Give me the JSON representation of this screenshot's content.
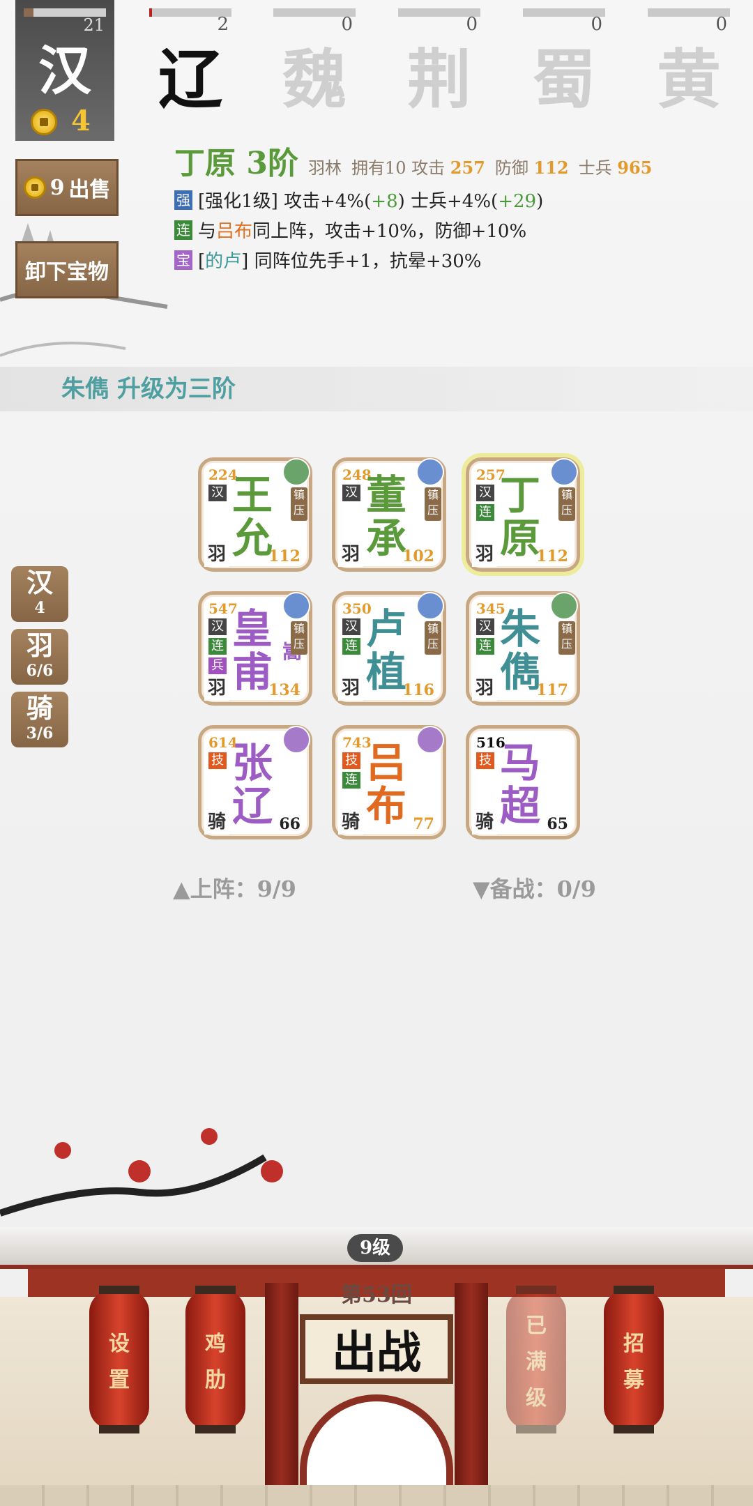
{
  "factions": {
    "main": {
      "name": "汉",
      "level": "21",
      "gold": "4"
    },
    "list": [
      {
        "name": "辽",
        "count": "2"
      },
      {
        "name": "魏",
        "count": "0"
      },
      {
        "name": "荆",
        "count": "0"
      },
      {
        "name": "蜀",
        "count": "0"
      },
      {
        "name": "黄",
        "count": "0"
      }
    ]
  },
  "buttons": {
    "sell_price": "9",
    "sell_label": "出售",
    "unequip_label": "卸下宝物"
  },
  "hero": {
    "name": "丁原",
    "rank": "3阶",
    "troop": "羽林",
    "owned": "拥有10",
    "atk_label": "攻击",
    "atk": "257",
    "def_label": "防御",
    "def": "112",
    "sol_label": "士兵",
    "sol": "965",
    "lines": [
      {
        "tag": "强",
        "pre": "[强化1级] 攻击+4%(",
        "v1": "+8",
        "mid": ") 士兵+4%(",
        "v2": "+29",
        "post": ")"
      },
      {
        "tag": "连",
        "pre": "与",
        "link": "吕布",
        "post": "同上阵，攻击+10%，防御+10%"
      },
      {
        "tag": "宝",
        "pre": "[",
        "link": "的卢",
        "post": "] 同阵位先手+1，抗晕+30%"
      }
    ]
  },
  "upgrade_hint": "朱儁 升级为三阶",
  "cards": [
    {
      "atk": "224",
      "c1": "王",
      "c2": "允",
      "def": "112",
      "cls": "羽",
      "color": "#5a9a3a",
      "tags": [
        "汉"
      ],
      "zy": "镇压"
    },
    {
      "atk": "248",
      "c1": "董",
      "c2": "承",
      "def": "102",
      "cls": "羽",
      "color": "#5a9a3a",
      "tags": [
        "汉"
      ],
      "zy": "镇压"
    },
    {
      "atk": "257",
      "c1": "丁",
      "c2": "原",
      "def": "112",
      "cls": "羽",
      "color": "#5a9a3a",
      "tags": [
        "汉",
        "连"
      ],
      "zy": "镇压"
    },
    {
      "atk": "547",
      "c1": "皇",
      "c2": "甫",
      "sub": "嵩",
      "def": "134",
      "cls": "羽",
      "color": "#9c5cc3",
      "tags": [
        "汉",
        "连",
        "兵"
      ],
      "zy": "镇压"
    },
    {
      "atk": "350",
      "c1": "卢",
      "c2": "植",
      "def": "116",
      "cls": "羽",
      "color": "#3f8f94",
      "tags": [
        "汉",
        "连"
      ],
      "zy": "镇压"
    },
    {
      "atk": "345",
      "c1": "朱",
      "c2": "儁",
      "def": "117",
      "cls": "羽",
      "color": "#3f8f94",
      "tags": [
        "汉",
        "连"
      ],
      "zy": "镇压"
    },
    {
      "atk": "614",
      "c1": "张",
      "c2": "辽",
      "def": "66",
      "cls": "骑",
      "color": "#9c5cc3",
      "tags": [
        "技"
      ]
    },
    {
      "atk": "743",
      "c1": "吕",
      "c2": "布",
      "def": "77",
      "cls": "骑",
      "color": "#e06a20",
      "tags": [
        "技",
        "连"
      ]
    },
    {
      "atk": "516",
      "c1": "马",
      "c2": "超",
      "def": "65",
      "cls": "骑",
      "color": "#9c5cc3",
      "tags": [
        "技"
      ]
    }
  ],
  "side_tags": [
    {
      "a": "汉",
      "b": "4"
    },
    {
      "a": "羽",
      "b": "6/6"
    },
    {
      "a": "骑",
      "b": "3/6"
    }
  ],
  "status": {
    "deployed": "▲上阵：9/9",
    "reserve": "▼备战：0/9"
  },
  "gate": {
    "level": "9级",
    "round": "第53回",
    "battle": "出战",
    "lanterns": [
      "设置",
      "鸡肋",
      "已满级",
      "招募"
    ]
  },
  "colors": {
    "accent_green": "#5a9a3a",
    "accent_orange": "#e39a2d",
    "wood": "#8b6a48",
    "gate_red": "#9c3323"
  }
}
